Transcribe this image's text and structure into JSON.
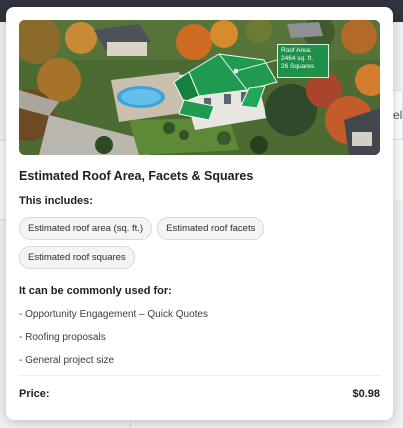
{
  "popover": {
    "hero_overlay": {
      "line1": "Roof Area:",
      "line2": "2464 sq. ft.",
      "line3": "26 Squares"
    },
    "title": "Estimated Roof Area, Facets & Squares",
    "includes_heading": "This includes:",
    "includes": [
      "Estimated roof area (sq. ft.)",
      "Estimated roof facets",
      "Estimated roof squares"
    ],
    "uses_heading": "It can be commonly used for:",
    "uses": [
      "- Opportunity Engagement – Quick Quotes",
      "- Roofing proposals",
      "- General project size"
    ],
    "price_label": "Price:",
    "price_value": "$0.98"
  },
  "background": {
    "partial_text": "ele"
  },
  "colors": {
    "roof_overlay_green": "#1f8f4a",
    "card_bg": "#ffffff",
    "chip_bg": "#f3f4f6",
    "chip_border": "#d5d8dd"
  }
}
